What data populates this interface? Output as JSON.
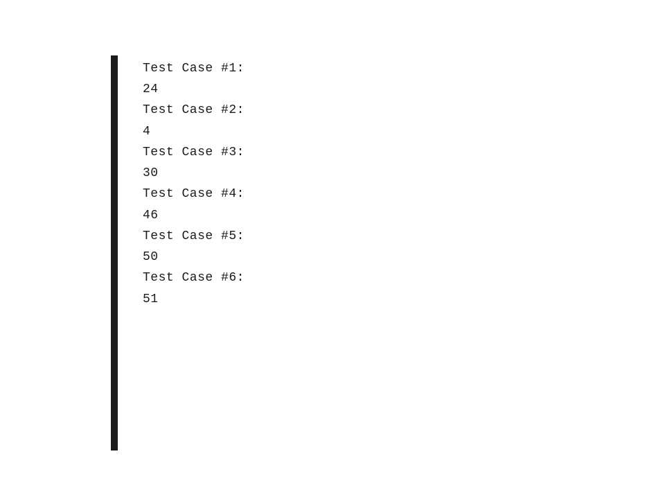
{
  "output": {
    "label_prefix": "Test Case #",
    "label_suffix": ":",
    "cases": [
      {
        "n": "1",
        "value": "24"
      },
      {
        "n": "2",
        "value": "4"
      },
      {
        "n": "3",
        "value": "30"
      },
      {
        "n": "4",
        "value": "46"
      },
      {
        "n": "5",
        "value": "50"
      },
      {
        "n": "6",
        "value": "51"
      }
    ]
  }
}
